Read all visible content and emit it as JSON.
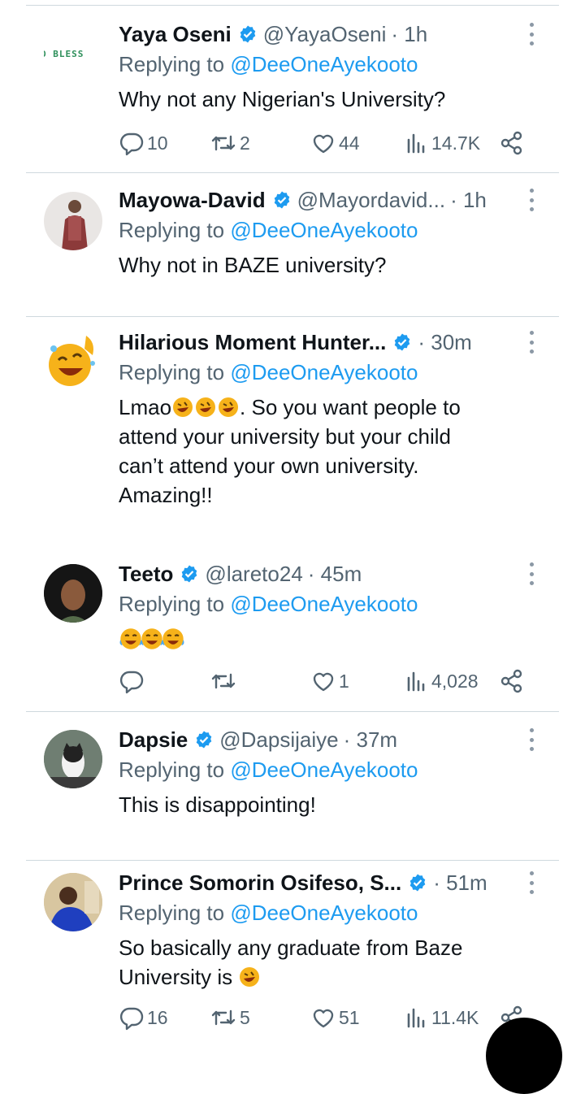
{
  "colors": {
    "link": "#1d9bf0",
    "muted": "#536471",
    "text": "#0f1419",
    "divider": "#cfd9de",
    "verified": "#1d9bf0"
  },
  "tweets": [
    {
      "name": "Yaya Oseni",
      "handle": "@YayaOseni",
      "time": "· 1h",
      "avatar_text": "D BLESS",
      "replying_label": "Replying to",
      "replying_to": "@DeeOneAyekooto",
      "text": "Why not any Nigerian's University?",
      "replies": "10",
      "reposts": "2",
      "likes": "44",
      "views": "14.7K"
    },
    {
      "name": "Mayowa-David",
      "handle": "@Mayordavid...",
      "time": "· 1h",
      "replying_label": "Replying to",
      "replying_to": "@DeeOneAyekooto",
      "text": "Why not in BAZE university?"
    },
    {
      "name": "Hilarious Moment Hunter...",
      "handle": "",
      "time": "· 30m",
      "replying_label": "Replying to",
      "replying_to": "@DeeOneAyekooto",
      "text_prefix": "Lmao",
      "text_rest": ". So you want people to attend your university but your child can’t attend your own university. Amazing!!"
    },
    {
      "name": "Teeto",
      "handle": "@lareto24",
      "time": "· 45m",
      "replying_label": "Replying to",
      "replying_to": "@DeeOneAyekooto",
      "text": "",
      "replies": "",
      "reposts": "",
      "likes": "1",
      "views": "4,028"
    },
    {
      "name": "Dapsie",
      "handle": "@Dapsijaiye",
      "time": "· 37m",
      "replying_label": "Replying to",
      "replying_to": "@DeeOneAyekooto",
      "text": "This is disappointing!"
    },
    {
      "name": "Prince Somorin Osifeso, S...",
      "handle": "",
      "time": "· 51m",
      "replying_label": "Replying to",
      "replying_to": "@DeeOneAyekooto",
      "text_line1": "So basically any graduate from Baze",
      "text_line2": "University is",
      "replies": "16",
      "reposts": "5",
      "likes": "51",
      "views": "11.4K"
    }
  ],
  "icons": {
    "verified": "verified-badge-icon",
    "more": "more-options-icon",
    "reply": "reply-icon",
    "repost": "repost-icon",
    "like": "like-icon",
    "views": "views-icon",
    "share": "share-icon",
    "laugh": "rolling-laughing-emoji",
    "joy": "tears-of-joy-emoji"
  }
}
